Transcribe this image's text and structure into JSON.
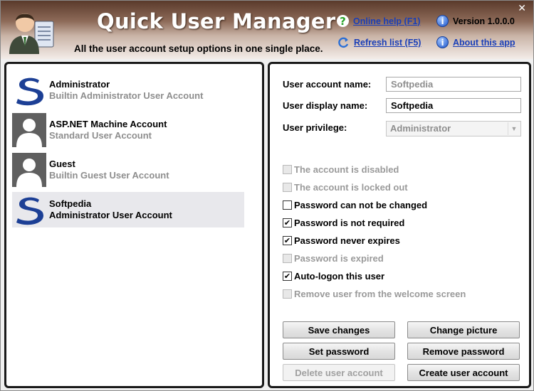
{
  "app": {
    "title": "Quick User Manager",
    "subtitle": "All the user account setup options in one single place.",
    "close_glyph": "✕"
  },
  "header_links": {
    "online_help": "Online help (F1)",
    "refresh_list": "Refresh list (F5)",
    "version": "Version 1.0.0.0",
    "about": "About this app"
  },
  "users": [
    {
      "name": "Administrator",
      "description": "Builtin Administrator User Account",
      "avatar": "softpedia-logo-icon"
    },
    {
      "name": "ASP.NET Machine Account",
      "description": "Standard User Account",
      "avatar": "default-user-icon"
    },
    {
      "name": "Guest",
      "description": "Builtin Guest User Account",
      "avatar": "default-user-icon"
    },
    {
      "name": "Softpedia",
      "description": "Administrator User Account",
      "avatar": "softpedia-logo-icon",
      "selected": true
    }
  ],
  "fields": {
    "account_name_label": "User account name:",
    "account_name_value": "Softpedia",
    "display_name_label": "User display name:",
    "display_name_value": "Softpedia",
    "privilege_label": "User privilege:",
    "privilege_value": "Administrator"
  },
  "options": [
    {
      "label": "The account is disabled",
      "checked": false,
      "enabled": false
    },
    {
      "label": "The account is locked out",
      "checked": false,
      "enabled": false
    },
    {
      "label": "Password can not be changed",
      "checked": false,
      "enabled": true
    },
    {
      "label": "Password is not required",
      "checked": true,
      "enabled": true
    },
    {
      "label": "Password never expires",
      "checked": true,
      "enabled": true
    },
    {
      "label": "Password is expired",
      "checked": false,
      "enabled": false
    },
    {
      "label": "Auto-logon this user",
      "checked": true,
      "enabled": true
    },
    {
      "label": "Remove user from the welcome screen",
      "checked": false,
      "enabled": false
    }
  ],
  "buttons": {
    "save_changes": "Save changes",
    "change_picture": "Change picture",
    "set_password": "Set password",
    "remove_password": "Remove password",
    "delete_user": "Delete user account",
    "create_user": "Create user account"
  },
  "colors": {
    "header_dark": "#5a3a2b",
    "link_blue": "#1a3fb8",
    "softpedia_blue": "#1c3f95",
    "disabled_gray": "#9a9a9a"
  }
}
